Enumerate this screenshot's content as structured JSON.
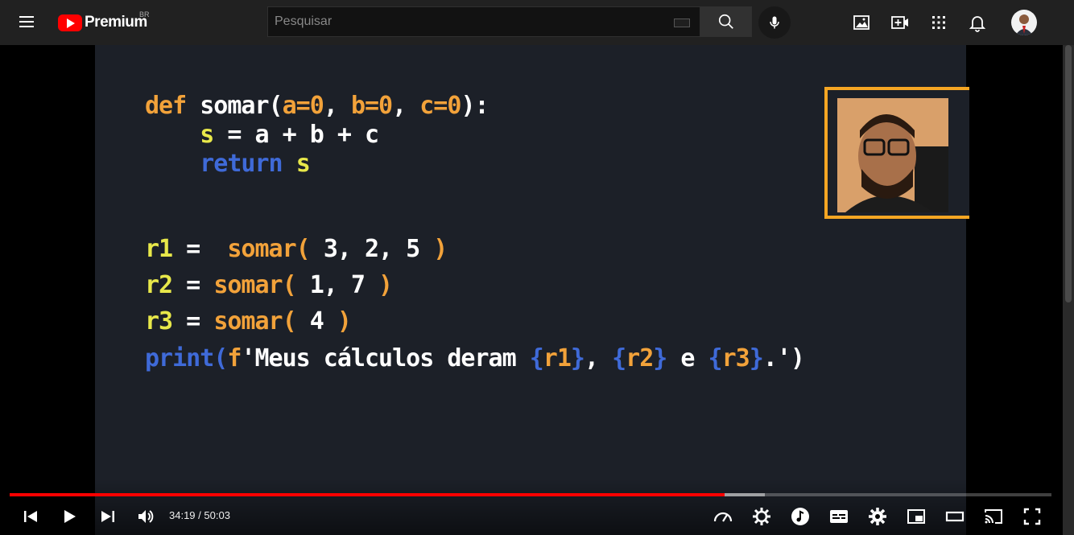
{
  "header": {
    "logo_text": "Premium",
    "region": "BR",
    "search_placeholder": "Pesquisar"
  },
  "video_content": {
    "lines": [
      [
        {
          "t": "def ",
          "c": "kw"
        },
        {
          "t": "somar(",
          "c": "wt"
        },
        {
          "t": "a=0",
          "c": "kw"
        },
        {
          "t": ", ",
          "c": "wt"
        },
        {
          "t": "b=0",
          "c": "kw"
        },
        {
          "t": ", ",
          "c": "wt"
        },
        {
          "t": "c=0",
          "c": "kw"
        },
        {
          "t": "):",
          "c": "wt"
        }
      ],
      [
        {
          "t": "    ",
          "c": "wt"
        },
        {
          "t": "s",
          "c": "ye"
        },
        {
          "t": " = a + b + c",
          "c": "wt"
        }
      ],
      [
        {
          "t": "    ",
          "c": "wt"
        },
        {
          "t": "return ",
          "c": "bl"
        },
        {
          "t": "s",
          "c": "ye"
        }
      ],
      [
        {
          "t": "r1",
          "c": "ye"
        },
        {
          "t": " =  ",
          "c": "wt"
        },
        {
          "t": "somar( ",
          "c": "kw"
        },
        {
          "t": "3, 2, 5",
          "c": "wt"
        },
        {
          "t": " )",
          "c": "kw"
        }
      ],
      [
        {
          "t": "r2",
          "c": "ye"
        },
        {
          "t": " = ",
          "c": "wt"
        },
        {
          "t": "somar( ",
          "c": "kw"
        },
        {
          "t": "1, 7",
          "c": "wt"
        },
        {
          "t": " )",
          "c": "kw"
        }
      ],
      [
        {
          "t": "r3",
          "c": "ye"
        },
        {
          "t": " = ",
          "c": "wt"
        },
        {
          "t": "somar( ",
          "c": "kw"
        },
        {
          "t": "4",
          "c": "wt"
        },
        {
          "t": " )",
          "c": "kw"
        }
      ],
      [
        {
          "t": "print(",
          "c": "bl"
        },
        {
          "t": "f",
          "c": "kw"
        },
        {
          "t": "'Meus cálculos deram ",
          "c": "wt"
        },
        {
          "t": "{",
          "c": "bl"
        },
        {
          "t": "r1",
          "c": "kw"
        },
        {
          "t": "}",
          "c": "bl"
        },
        {
          "t": ", ",
          "c": "wt"
        },
        {
          "t": "{",
          "c": "bl"
        },
        {
          "t": "r2",
          "c": "kw"
        },
        {
          "t": "}",
          "c": "bl"
        },
        {
          "t": " e ",
          "c": "wt"
        },
        {
          "t": "{",
          "c": "bl"
        },
        {
          "t": "r3",
          "c": "kw"
        },
        {
          "t": "}",
          "c": "bl"
        },
        {
          "t": ".')",
          "c": "wt"
        }
      ]
    ]
  },
  "player": {
    "current_time": "34:19",
    "separator": " / ",
    "duration": "50:03",
    "played_fraction": 0.686,
    "buffered_fraction": 0.725
  },
  "icons": {
    "menu": "menu-icon",
    "search": "search-icon",
    "mic": "mic-icon",
    "create": "create-icon",
    "apps": "apps-icon",
    "notifications": "bell-icon",
    "prev": "previous-icon",
    "play": "play-icon",
    "next": "next-icon",
    "volume": "volume-icon",
    "speed": "speed-icon",
    "autoplay": "gear-icon",
    "music": "music-icon",
    "captions": "captions-icon",
    "settings": "settings-icon",
    "miniplayer": "miniplayer-icon",
    "theater": "theater-icon",
    "cast": "cast-icon",
    "fullscreen": "fullscreen-icon"
  }
}
